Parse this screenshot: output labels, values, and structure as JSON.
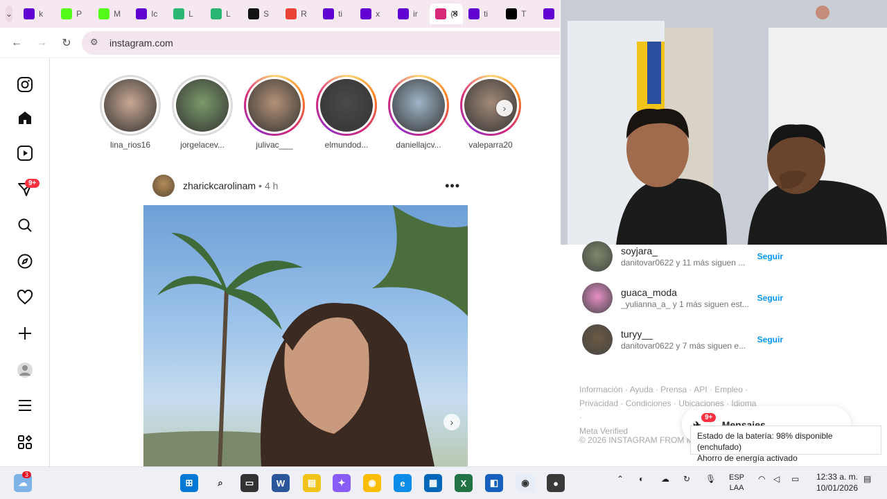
{
  "browser": {
    "tabs": [
      {
        "label": "k",
        "icon": "yahoo-icon",
        "color": "#6001d2"
      },
      {
        "label": "P",
        "icon": "kick-icon",
        "color": "#53fc18"
      },
      {
        "label": "M",
        "icon": "kick-icon",
        "color": "#53fc18"
      },
      {
        "label": "Ic",
        "icon": "yahoo-icon",
        "color": "#6001d2"
      },
      {
        "label": "L",
        "icon": "logo-icon",
        "color": "#2bb673"
      },
      {
        "label": "L",
        "icon": "logo-icon",
        "color": "#2bb673"
      },
      {
        "label": "S",
        "icon": "github-icon",
        "color": "#111111"
      },
      {
        "label": "R",
        "icon": "gmail-icon",
        "color": "#ea4335"
      },
      {
        "label": "ti",
        "icon": "yahoo-icon",
        "color": "#6001d2"
      },
      {
        "label": "x",
        "icon": "yahoo-icon",
        "color": "#6001d2"
      },
      {
        "label": "ir",
        "icon": "yahoo-icon",
        "color": "#6001d2"
      },
      {
        "label": "(9",
        "icon": "instagram-icon",
        "color": "#d62976",
        "active": true
      },
      {
        "label": "ti",
        "icon": "yahoo-icon",
        "color": "#6001d2"
      },
      {
        "label": "T",
        "icon": "tiktok-icon",
        "color": "#000000"
      },
      {
        "label": "",
        "icon": "yahoo-icon",
        "color": "#6001d2"
      }
    ],
    "url": "instagram.com"
  },
  "sidebar": {
    "notifications_badge": "9+"
  },
  "stories": [
    {
      "username": "lina_rios16",
      "seen": true,
      "photo": "#c9a892"
    },
    {
      "username": "jorgelacev...",
      "seen": true,
      "photo": "#7b9a6a"
    },
    {
      "username": "julivac___",
      "seen": false,
      "photo": "#b59277"
    },
    {
      "username": "elmundod...",
      "seen": false,
      "photo": "#4a4a4a"
    },
    {
      "username": "daniellajcv...",
      "seen": false,
      "photo": "#9fb6c9"
    },
    {
      "username": "valeparra20",
      "seen": false,
      "photo": "#a38a78"
    }
  ],
  "post": {
    "username": "zharickcarolinam",
    "separator": "•",
    "time": "4 h"
  },
  "suggestions": [
    {
      "name": "soyjara_",
      "sub": "danitovar0622 y 11 más siguen ...",
      "action": "Seguir",
      "avatar": "#7d8a6a"
    },
    {
      "name": "guaca_moda",
      "sub": "_yulianna_a_ y 1 más siguen est...",
      "action": "Seguir",
      "avatar": "#e88fc8"
    },
    {
      "name": "turyy__",
      "sub": "danitovar0622 y 7 más siguen e...",
      "action": "Seguir",
      "avatar": "#6b5a42"
    }
  ],
  "footer": {
    "line1": "Información · Ayuda · Prensa · API · Empleo ·",
    "line2": "Privacidad · Condiciones · Ubicaciones · Idioma ·",
    "line3": "Meta Verified",
    "copyright": "© 2026 INSTAGRAM FROM M"
  },
  "messages": {
    "label": "Mensajes",
    "badge": "9+"
  },
  "tooltip": {
    "line1": "Estado de la batería: 98% disponible (enchufado)",
    "line2": "Ahorro de energía activado"
  },
  "taskbar": {
    "weather_badge": "3",
    "lang1": "ESP",
    "lang2": "LAA",
    "time": "12:33 a. m.",
    "date": "10/01/2026"
  }
}
